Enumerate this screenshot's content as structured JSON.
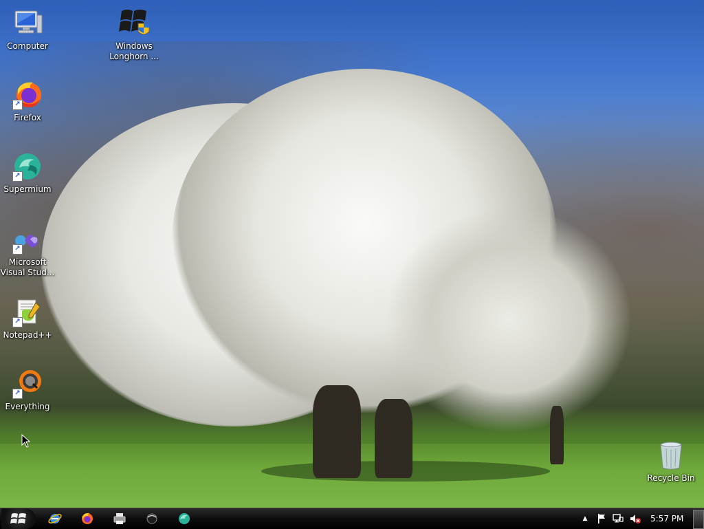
{
  "desktop": {
    "icons": [
      {
        "label": "Computer",
        "icon": "computer-icon"
      },
      {
        "label": "Windows\nLonghorn ...",
        "icon": "windows-flag-icon"
      },
      {
        "label": "Firefox",
        "icon": "firefox-icon"
      },
      {
        "label": "Supermium",
        "icon": "supermium-icon"
      },
      {
        "label": "Microsoft\nVisual Stud...",
        "icon": "visual-studio-icon"
      },
      {
        "label": "Notepad++",
        "icon": "notepad-plus-plus-icon"
      },
      {
        "label": "Everything",
        "icon": "everything-search-icon"
      },
      {
        "label": "Recycle Bin",
        "icon": "recycle-bin-icon"
      }
    ]
  },
  "taskbar": {
    "start_icon": "windows-start-orb-icon",
    "pinned": [
      {
        "icon": "internet-explorer-icon"
      },
      {
        "icon": "firefox-icon"
      },
      {
        "icon": "printer-icon"
      },
      {
        "icon": "media-orb-icon"
      },
      {
        "icon": "supermium-icon"
      }
    ],
    "tray": {
      "show_hidden_glyph": "▲",
      "clock": "5:57 PM"
    }
  },
  "colors": {
    "taskbar": "#0d0d0d",
    "label_text": "#ffffff",
    "grass": "#6faa3c",
    "sky": "#3a6cc7"
  }
}
